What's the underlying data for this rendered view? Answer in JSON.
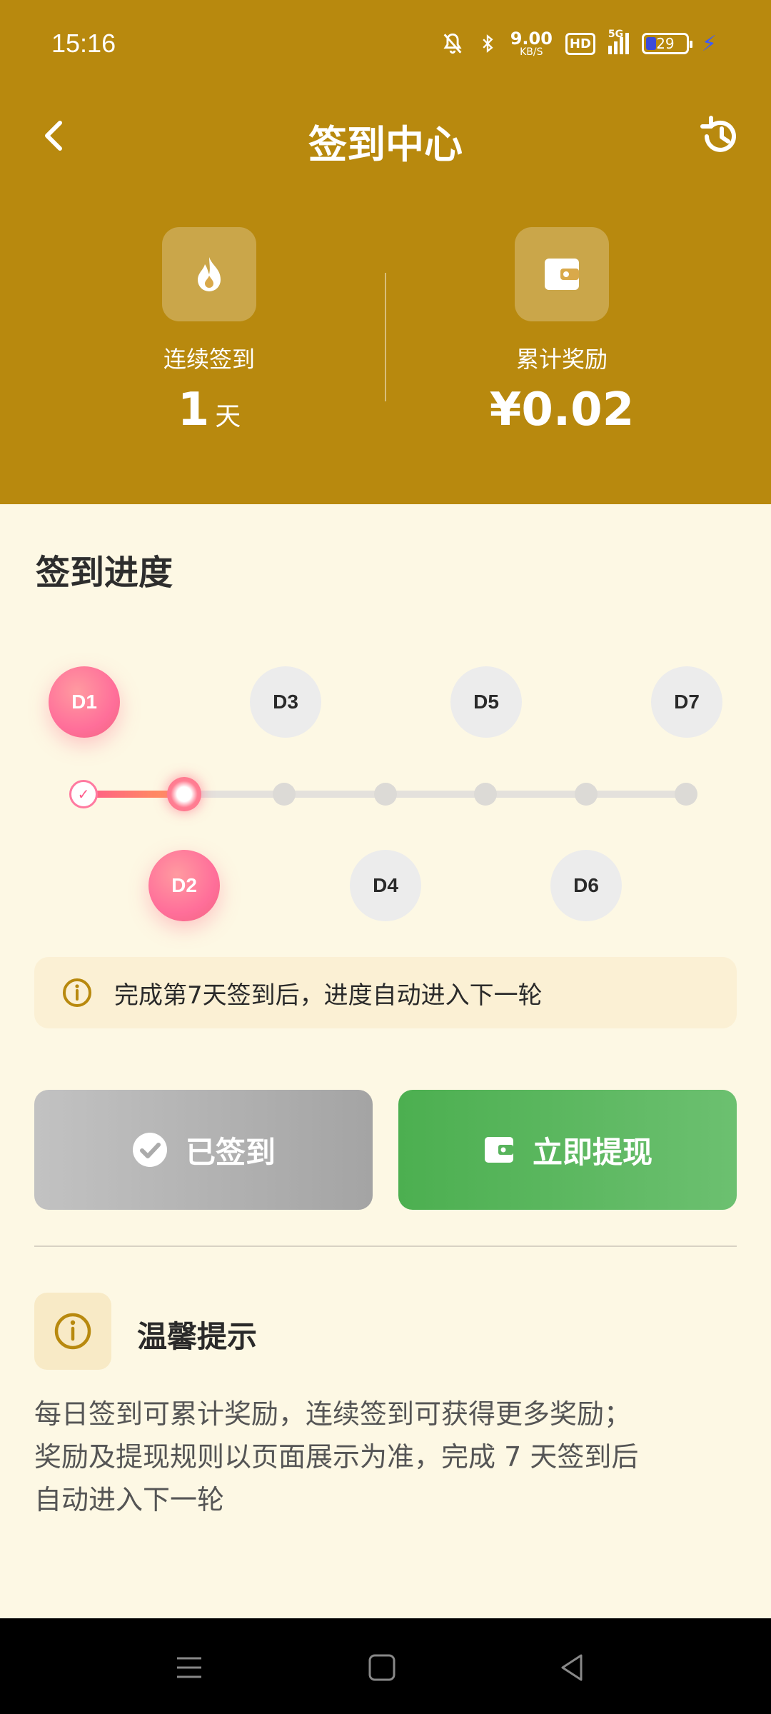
{
  "status": {
    "time": "15:16",
    "net_speed": "9.00",
    "net_unit": "KB/S",
    "hd": "HD",
    "signal": "5G",
    "battery": "29"
  },
  "nav": {
    "title": "签到中心"
  },
  "stats": {
    "streak_label": "连续签到",
    "streak_value": "1",
    "streak_unit": "天",
    "reward_label": "累计奖励",
    "reward_value": "¥0.02"
  },
  "progress": {
    "title": "签到进度",
    "days": [
      "D1",
      "D2",
      "D3",
      "D4",
      "D5",
      "D6",
      "D7"
    ],
    "completed": 1,
    "current": 2
  },
  "notice": {
    "text": "完成第7天签到后，进度自动进入下一轮"
  },
  "buttons": {
    "signed_label": "已签到",
    "withdraw_label": "立即提现"
  },
  "tips": {
    "title": "温馨提示",
    "lines": [
      "每日签到可累计奖励，连续签到可获得更多奖励；",
      "奖励及提现规则以页面展示为准，完成 7 天签到后",
      "自动进入下一轮"
    ]
  },
  "colors": {
    "header": "#B8890E",
    "background": "#FDF8E4",
    "accent_pink": "#FF6F9A",
    "green": "#4CAF50"
  }
}
